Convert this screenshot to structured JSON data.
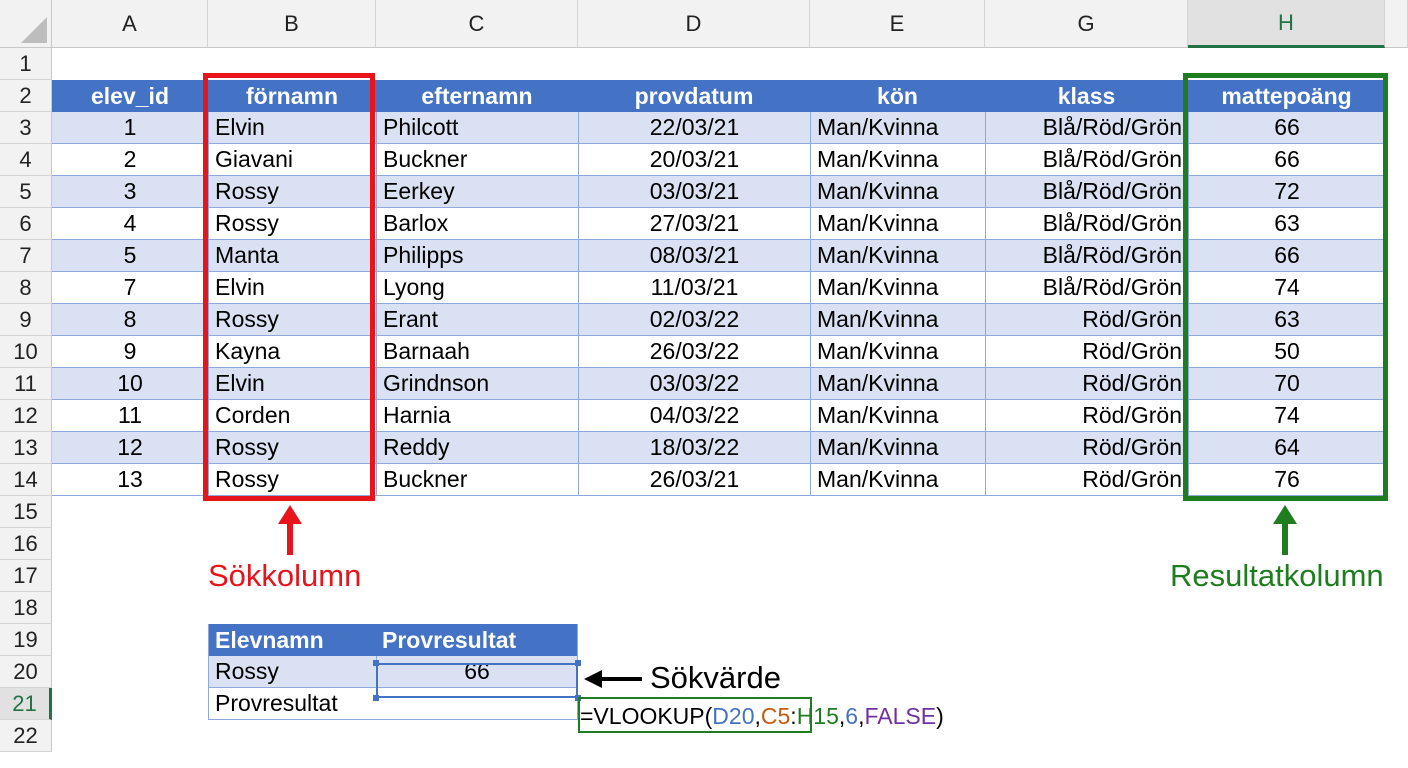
{
  "columns": [
    "A",
    "B",
    "C",
    "D",
    "E",
    "G",
    "H"
  ],
  "selected_column": "H",
  "rows": [
    "1",
    "2",
    "3",
    "4",
    "5",
    "6",
    "7",
    "8",
    "9",
    "10",
    "11",
    "12",
    "13",
    "14",
    "15",
    "16",
    "17",
    "18",
    "19",
    "20",
    "21",
    "22"
  ],
  "selected_row": "21",
  "table": {
    "headers": [
      "elev_id",
      "förnamn",
      "efternamn",
      "provdatum",
      "kön",
      "klass",
      "mattepoäng"
    ],
    "data": [
      [
        "1",
        "Elvin",
        "Philcott",
        "22/03/21",
        "Man/Kvinna",
        "Blå/Röd/Grön",
        "66"
      ],
      [
        "2",
        "Giavani",
        "Buckner",
        "20/03/21",
        "Man/Kvinna",
        "Blå/Röd/Grön",
        "66"
      ],
      [
        "3",
        "Rossy",
        "Eerkey",
        "03/03/21",
        "Man/Kvinna",
        "Blå/Röd/Grön",
        "72"
      ],
      [
        "4",
        "Rossy",
        "Barlox",
        "27/03/21",
        "Man/Kvinna",
        "Blå/Röd/Grön",
        "63"
      ],
      [
        "5",
        "Manta",
        "Philipps",
        "08/03/21",
        "Man/Kvinna",
        "Blå/Röd/Grön",
        "66"
      ],
      [
        "7",
        "Elvin",
        "Lyong",
        "11/03/21",
        "Man/Kvinna",
        "Blå/Röd/Grön",
        "74"
      ],
      [
        "8",
        "Rossy",
        "Erant",
        "02/03/22",
        "Man/Kvinna",
        "Röd/Grön",
        "63"
      ],
      [
        "9",
        "Kayna",
        "Barnaah",
        "26/03/22",
        "Man/Kvinna",
        "Röd/Grön",
        "50"
      ],
      [
        "10",
        "Elvin",
        "Grindnson",
        "03/03/22",
        "Man/Kvinna",
        "Röd/Grön",
        "70"
      ],
      [
        "11",
        "Corden",
        "Harnia",
        "04/03/22",
        "Man/Kvinna",
        "Röd/Grön",
        "74"
      ],
      [
        "12",
        "Rossy",
        "Reddy",
        "18/03/22",
        "Man/Kvinna",
        "Röd/Grön",
        "64"
      ],
      [
        "13",
        "Rossy",
        "Buckner",
        "26/03/21",
        "Man/Kvinna",
        "Röd/Grön",
        "76"
      ]
    ]
  },
  "annotations": {
    "search_column": "Sökkolumn",
    "result_column": "Resultatkolumn",
    "lookup_value": "Sökvärde"
  },
  "lookup": {
    "header_name": "Elevnamn",
    "header_result": "Provresultat",
    "name_value": "Rossy",
    "result_value": "66",
    "result_label": "Provresultat"
  },
  "formula": {
    "parts": [
      "=VLOOKUP(",
      "D20",
      ",",
      "C5",
      ":",
      "H15",
      ",",
      "6",
      ",",
      "FALSE",
      ")"
    ]
  },
  "colors": {
    "header_blue": "#4472c4",
    "band_blue": "#d9e1f2",
    "red": "#e8141b",
    "green": "#1e7d1e",
    "excel_green": "#217346",
    "ref_blue": "#4472c4",
    "ref_orange": "#c55a11",
    "ref_green": "#1e7d1e",
    "ref_purple": "#7030a0"
  }
}
